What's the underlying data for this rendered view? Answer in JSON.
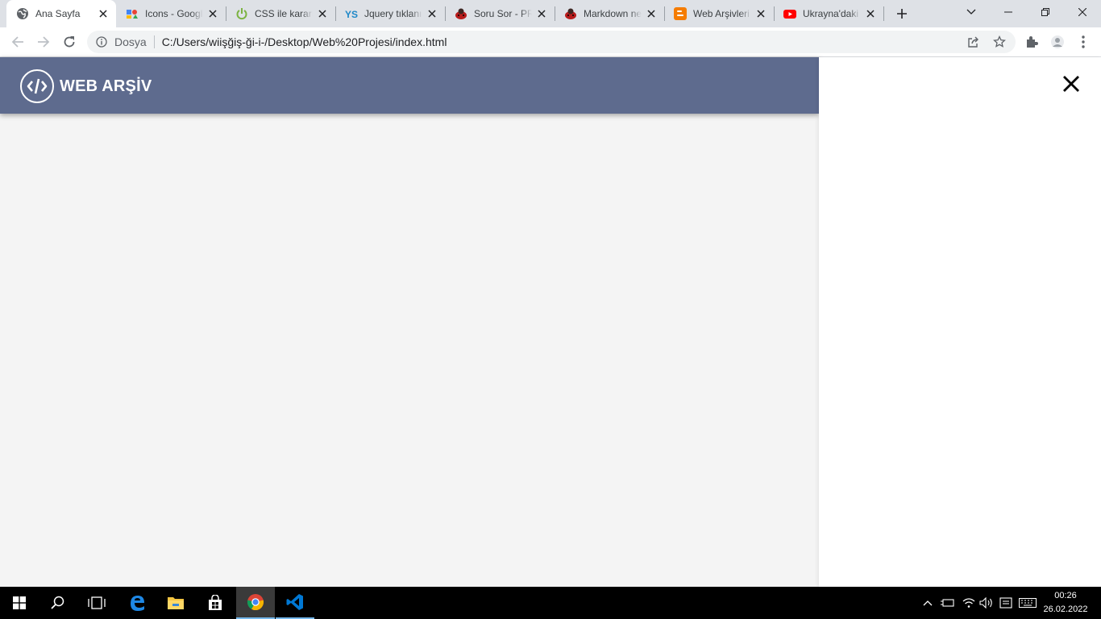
{
  "browser": {
    "tabs": [
      {
        "title": "Ana Sayfa",
        "icon": "globe-icon",
        "active": true
      },
      {
        "title": "Icons - Google Fonts",
        "icon": "google-fonts-icon",
        "active": false
      },
      {
        "title": "CSS ile karartma",
        "icon": "power-icon",
        "active": false
      },
      {
        "title": "Jquery tıklanınca",
        "icon": "yardimsever-icon",
        "active": false
      },
      {
        "title": "Soru Sor - PRO",
        "icon": "ladybug-icon",
        "active": false
      },
      {
        "title": "Markdown nedir",
        "icon": "ladybug-icon",
        "active": false
      },
      {
        "title": "Web Arşivleri",
        "icon": "blogger-icon",
        "active": false
      },
      {
        "title": "Ukrayna'daki",
        "icon": "youtube-icon",
        "active": false
      }
    ],
    "address": {
      "security_chip": "Dosya",
      "url": "C:/Users/wiişğiş-ği-i-/Desktop/Web%20Projesi/index.html"
    }
  },
  "site": {
    "brand": "WEB ARŞİV",
    "header_color": "#5e6b8e",
    "panel_close_icon": "close-icon"
  },
  "taskbar": {
    "time": "00:26",
    "date": "26.02.2022",
    "apps": [
      "start-icon",
      "search-icon",
      "task-view-icon",
      "edge-icon",
      "file-explorer-icon",
      "store-icon",
      "chrome-icon",
      "vscode-icon"
    ]
  }
}
